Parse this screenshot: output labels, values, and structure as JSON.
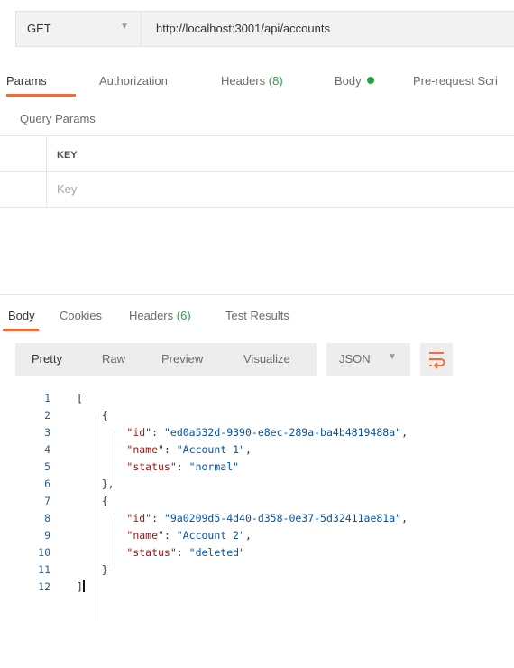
{
  "request": {
    "method": "GET",
    "url": "http://localhost:3001/api/accounts"
  },
  "request_tabs": [
    {
      "label": "Params"
    },
    {
      "label": "Authorization"
    },
    {
      "label": "Headers",
      "count": "(8)"
    },
    {
      "label": "Body"
    },
    {
      "label": "Pre-request Scri"
    }
  ],
  "query_params": {
    "title": "Query Params",
    "key_header": "KEY",
    "key_placeholder": "Key"
  },
  "response_tabs": [
    {
      "label": "Body"
    },
    {
      "label": "Cookies"
    },
    {
      "label": "Headers",
      "count": "(6)"
    },
    {
      "label": "Test Results"
    }
  ],
  "response_toolbar": {
    "formats": [
      "Pretty",
      "Raw",
      "Preview",
      "Visualize"
    ],
    "language": "JSON"
  },
  "response_body": {
    "line_numbers": [
      "1",
      "2",
      "3",
      "4",
      "5",
      "6",
      "7",
      "8",
      "9",
      "10",
      "11",
      "12"
    ],
    "records": [
      {
        "id": "ed0a532d-9390-e8ec-289a-ba4b4819488a",
        "name": "Account 1",
        "status": "normal"
      },
      {
        "id": "9a0209d5-4d40-d358-0e37-5d32411ae81a",
        "name": "Account 2",
        "status": "deleted"
      }
    ]
  },
  "colors": {
    "accent": "#f26b3a",
    "status_green": "#26a541",
    "json_key": "#a31515",
    "json_string": "#0451a5"
  }
}
